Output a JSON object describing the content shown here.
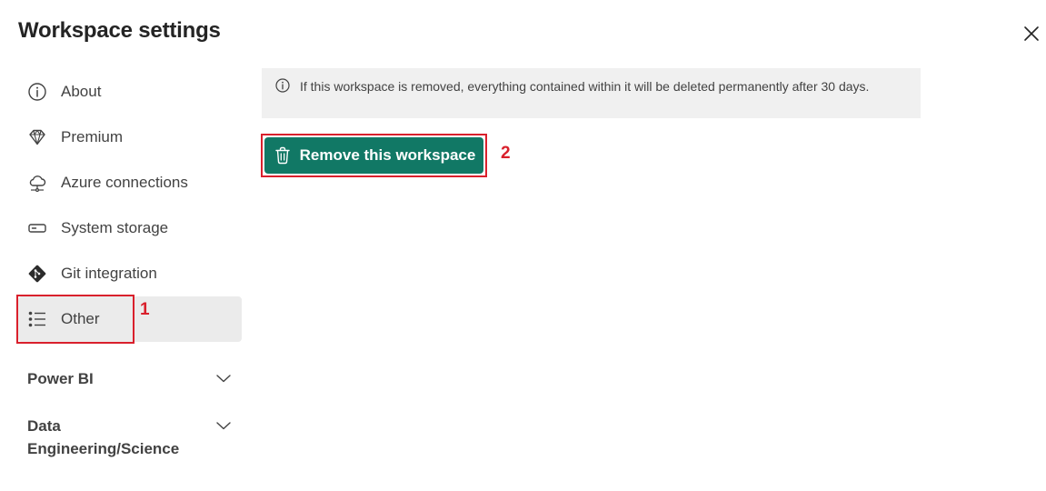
{
  "panel": {
    "title": "Workspace settings",
    "close_icon": "close-icon"
  },
  "sidebar": {
    "items": [
      {
        "label": "About",
        "icon": "info-icon"
      },
      {
        "label": "Premium",
        "icon": "diamond-icon"
      },
      {
        "label": "Azure connections",
        "icon": "cloud-connection-icon"
      },
      {
        "label": "System storage",
        "icon": "storage-icon"
      },
      {
        "label": "Git integration",
        "icon": "git-icon"
      },
      {
        "label": "Other",
        "icon": "list-icon",
        "selected": true
      }
    ],
    "sections": [
      {
        "label": "Power BI",
        "icon": "chevron-down-icon"
      },
      {
        "label": "Data Engineering/Science",
        "icon": "chevron-down-icon"
      }
    ]
  },
  "main": {
    "info_message": "If this workspace is removed, everything contained within it will be deleted permanently after 30 days.",
    "remove_button_label": "Remove this workspace"
  },
  "annotations": {
    "step1": "1",
    "step2": "2",
    "color": "#d9202c"
  },
  "colors": {
    "primary_button": "#117865",
    "selected_nav_bg": "#ebebeb",
    "info_bar_bg": "#f0f0f0"
  }
}
